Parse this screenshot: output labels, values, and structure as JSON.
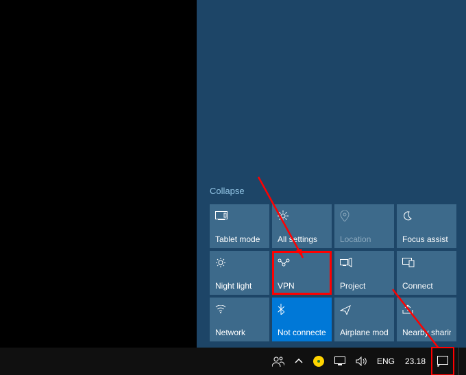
{
  "action_center": {
    "collapse_label": "Collapse",
    "tiles": [
      {
        "id": "tablet-mode",
        "label": "Tablet mode",
        "icon": "tablet"
      },
      {
        "id": "all-settings",
        "label": "All settings",
        "icon": "gear"
      },
      {
        "id": "location",
        "label": "Location",
        "icon": "location",
        "dim": true
      },
      {
        "id": "focus-assist",
        "label": "Focus assist",
        "icon": "moon"
      },
      {
        "id": "night-light",
        "label": "Night light",
        "icon": "sun"
      },
      {
        "id": "vpn",
        "label": "VPN",
        "icon": "vpn",
        "highlight": true
      },
      {
        "id": "project",
        "label": "Project",
        "icon": "project"
      },
      {
        "id": "connect",
        "label": "Connect",
        "icon": "connect"
      },
      {
        "id": "network",
        "label": "Network",
        "icon": "wifi"
      },
      {
        "id": "bluetooth",
        "label": "Not connected",
        "icon": "bluetooth",
        "active": true
      },
      {
        "id": "airplane-mode",
        "label": "Airplane mode",
        "icon": "airplane"
      },
      {
        "id": "nearby-sharing",
        "label": "Nearby sharing",
        "icon": "share"
      }
    ]
  },
  "taskbar": {
    "language": "ENG",
    "time": "23.18"
  }
}
